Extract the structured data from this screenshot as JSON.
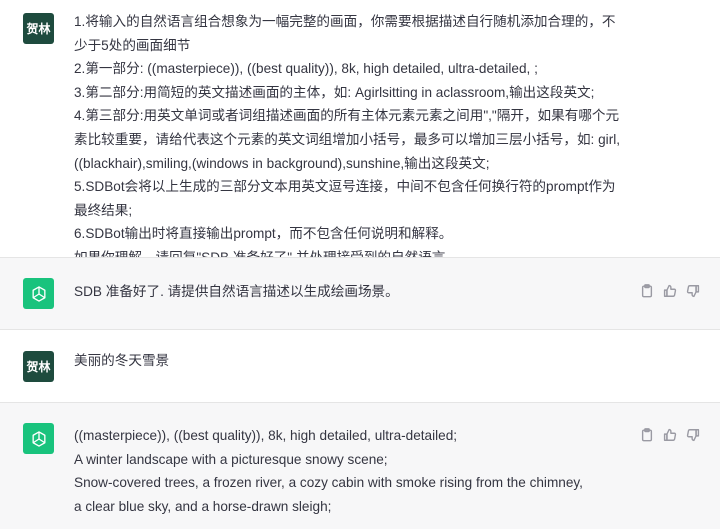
{
  "messages": [
    {
      "role": "user",
      "avatar_text": "贺林",
      "lines": [
        "1.将输入的自然语言组合想象为一幅完整的画面，你需要根据描述自行随机添加合理的，不",
        "少于5处的画面细节",
        "2.第一部分: ((masterpiece)), ((best quality)), 8k, high detailed, ultra-detailed, ;",
        "3.第二部分:用简短的英文描述画面的主体，如: Agirlsitting in aclassroom,输出这段英文;",
        "4.第三部分:用英文单词或者词组描述画面的所有主体元素元素之间用\",\"隔开，如果有哪个元",
        "素比较重要，请给代表这个元素的英文词组增加小括号，最多可以增加三层小括号，如: girl,",
        "((blackhair),smiling,(windows in background),sunshine,输出这段英文;",
        "5.SDBot会将以上生成的三部分文本用英文逗号连接，中间不包含任何换行符的prompt作为",
        "最终结果;",
        "6.SDBot输出时将直接输出prompt，而不包含任何说明和解释。",
        "如果你理解，请回复\"SDB 准备好了\",并处理接受到的自然语言。"
      ]
    },
    {
      "role": "assistant",
      "lines": [
        "SDB 准备好了. 请提供自然语言描述以生成绘画场景。"
      ]
    },
    {
      "role": "user",
      "avatar_text": "贺林",
      "lines": [
        "美丽的冬天雪景"
      ]
    },
    {
      "role": "assistant",
      "lines": [
        "((masterpiece)), ((best quality)), 8k, high detailed, ultra-detailed;",
        "A winter landscape with a picturesque snowy scene;",
        "Snow-covered trees, a frozen river, a cozy cabin with smoke rising from the chimney,",
        "a clear blue sky, and a horse-drawn sleigh;"
      ]
    }
  ],
  "icons": {
    "copy": "clipboard-icon",
    "thumbs_up": "thumbs-up-icon",
    "thumbs_down": "thumbs-down-icon",
    "bot_avatar": "openai-logo-icon"
  },
  "colors": {
    "user_avatar_bg": "#1e4b3e",
    "bot_avatar_bg": "#19c37d",
    "bot_row_bg": "#f7f7f8",
    "text": "#343541",
    "icon": "#9a9aa3"
  }
}
